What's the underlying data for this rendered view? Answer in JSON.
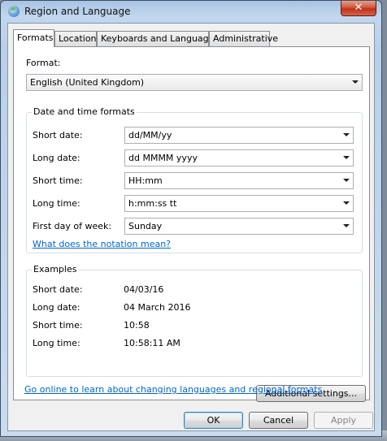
{
  "window": {
    "title": "Region and Language",
    "close_glyph": "✕"
  },
  "tabs": [
    {
      "label": "Formats",
      "active": true
    },
    {
      "label": "Location",
      "active": false
    },
    {
      "label": "Keyboards and Languages",
      "active": false
    },
    {
      "label": "Administrative",
      "active": false
    }
  ],
  "format": {
    "label": "Format:",
    "value": "English (United Kingdom)"
  },
  "date_time_group": {
    "legend": "Date and time formats",
    "rows": [
      {
        "label": "Short date:",
        "value": "dd/MM/yy"
      },
      {
        "label": "Long date:",
        "value": "dd MMMM yyyy"
      },
      {
        "label": "Short time:",
        "value": "HH:mm"
      },
      {
        "label": "Long time:",
        "value": "h:mm:ss tt"
      },
      {
        "label": "First day of week:",
        "value": "Sunday"
      }
    ],
    "notation_link": "What does the notation mean?"
  },
  "examples_group": {
    "legend": "Examples",
    "rows": [
      {
        "label": "Short date:",
        "value": "04/03/16"
      },
      {
        "label": "Long date:",
        "value": "04 March 2016"
      },
      {
        "label": "Short time:",
        "value": "10:58"
      },
      {
        "label": "Long time:",
        "value": "10:58:11 AM"
      }
    ]
  },
  "additional_settings_label": "Additional settings...",
  "online_link": "Go online to learn about changing languages and regional formats",
  "buttons": {
    "ok": "OK",
    "cancel": "Cancel",
    "apply": "Apply"
  },
  "colors": {
    "link": "#0066cc",
    "close_red": "#c0301b",
    "title_glass": "#b9d0ea"
  }
}
